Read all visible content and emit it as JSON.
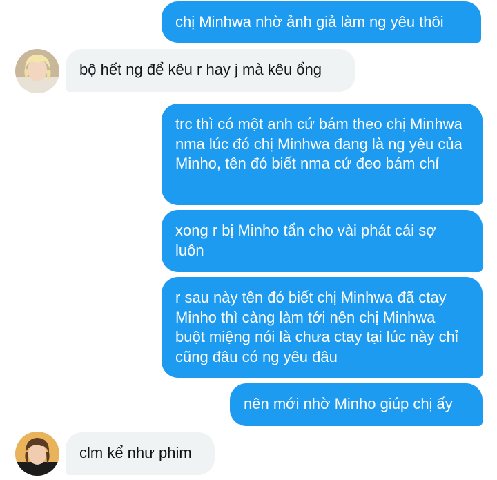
{
  "messages": [
    {
      "id": "m1",
      "direction": "outgoing",
      "text": "chị Minhwa nhờ ảnh giả làm ng yêu thôi"
    },
    {
      "id": "m2",
      "direction": "incoming",
      "avatar": "blonde-avatar",
      "text": "bộ hết ng để kêu r hay j mà kêu ổng"
    },
    {
      "id": "m3",
      "direction": "outgoing",
      "text": "trc thì có một anh cứ bám theo chị Minhwa nma lúc đó chị Minhwa đang là ng yêu của Minho, tên đó biết nma cứ đeo bám chỉ"
    },
    {
      "id": "m4",
      "direction": "outgoing",
      "text": "xong r bị Minho tẩn cho vài phát cái sợ luôn"
    },
    {
      "id": "m5",
      "direction": "outgoing",
      "text": "r sau này tên đó biết chị Minhwa đã ctay Minho thì càng làm tới nên chị Minhwa buột miệng nói là chưa ctay tại lúc này chỉ cũng đâu có ng yêu đâu"
    },
    {
      "id": "m6",
      "direction": "outgoing",
      "text": "nên mới nhờ Minho giúp chị ấy"
    },
    {
      "id": "m7",
      "direction": "incoming",
      "avatar": "brown-hair-avatar",
      "text": "clm kể như phim"
    }
  ],
  "colors": {
    "outgoing_bubble": "#1d9bf0",
    "incoming_bubble": "#eff3f4",
    "outgoing_text": "#ffffff",
    "incoming_text": "#0f1419"
  }
}
